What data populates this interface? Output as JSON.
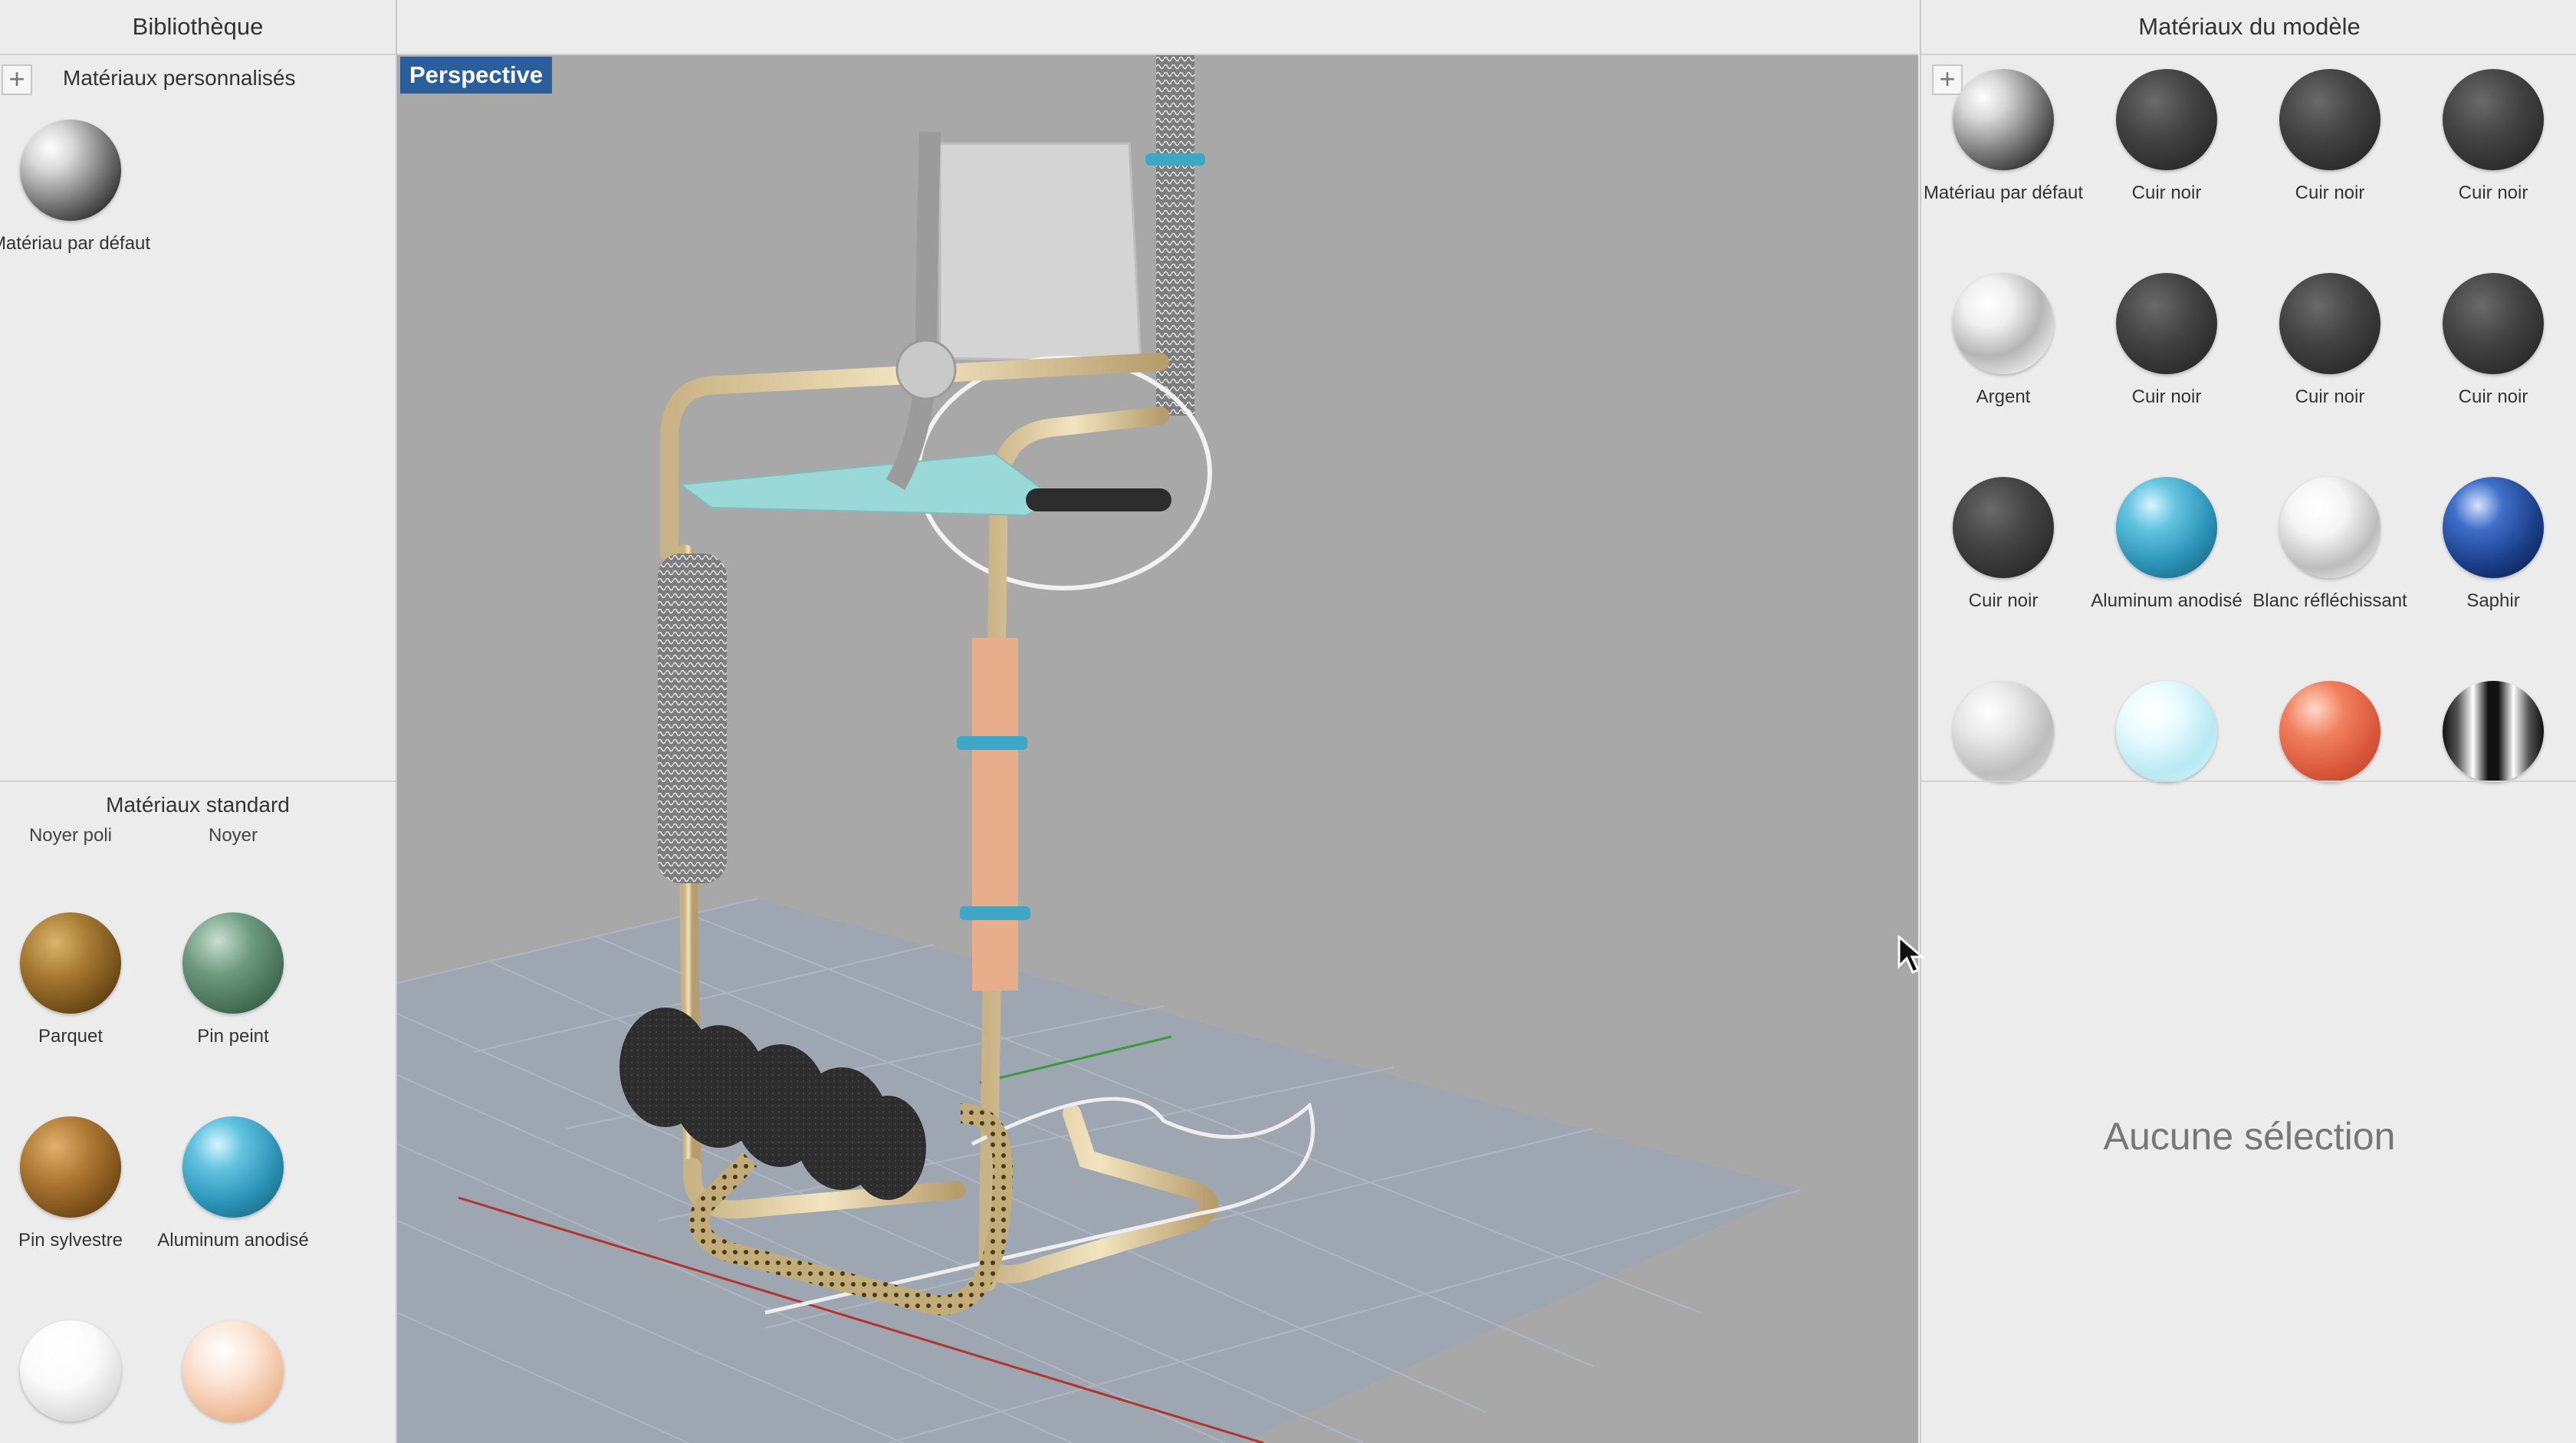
{
  "library": {
    "title": "Bibliothèque",
    "add_label": "+",
    "custom_section": "Matériaux personnalisés",
    "custom_materials": [
      {
        "label": "Matériau par défaut",
        "icon": "material-default"
      }
    ],
    "standard_section": "Matériaux standard",
    "cut_labels": [
      "Noyer poli",
      "Noyer"
    ],
    "standard_materials": [
      {
        "label": "Parquet",
        "icon": "material-parquet"
      },
      {
        "label": "Pin peint",
        "icon": "material-pin-peint"
      },
      {
        "label": "Pin sylvestre",
        "icon": "material-pin-sylvestre"
      },
      {
        "label": "Aluminum anodisé",
        "icon": "material-aluminum"
      },
      {
        "label": "",
        "icon": "material-white"
      },
      {
        "label": "",
        "icon": "material-peach"
      }
    ]
  },
  "viewport": {
    "tag": "Perspective"
  },
  "model_materials": {
    "title": "Matériaux du modèle",
    "add_label": "+",
    "items": [
      {
        "label": "Matériau par défaut",
        "icon": "material-default"
      },
      {
        "label": "Cuir noir",
        "icon": "material-cuir-noir"
      },
      {
        "label": "Cuir noir",
        "icon": "material-cuir-noir"
      },
      {
        "label": "Cuir noir",
        "icon": "material-cuir-noir"
      },
      {
        "label": "Argent",
        "icon": "material-argent"
      },
      {
        "label": "Cuir noir",
        "icon": "material-cuir-noir"
      },
      {
        "label": "Cuir noir",
        "icon": "material-cuir-noir"
      },
      {
        "label": "Cuir noir",
        "icon": "material-cuir-noir"
      },
      {
        "label": "Cuir noir",
        "icon": "material-cuir-noir"
      },
      {
        "label": "Aluminum anodisé",
        "icon": "material-aluminum"
      },
      {
        "label": "Blanc réfléchissant",
        "icon": "material-blanc"
      },
      {
        "label": "Saphir",
        "icon": "material-saphir"
      },
      {
        "label": "",
        "icon": "material-silver"
      },
      {
        "label": "",
        "icon": "material-icy"
      },
      {
        "label": "",
        "icon": "material-copper"
      },
      {
        "label": "",
        "icon": "material-striped"
      }
    ],
    "no_selection": "Aucune sélection"
  }
}
